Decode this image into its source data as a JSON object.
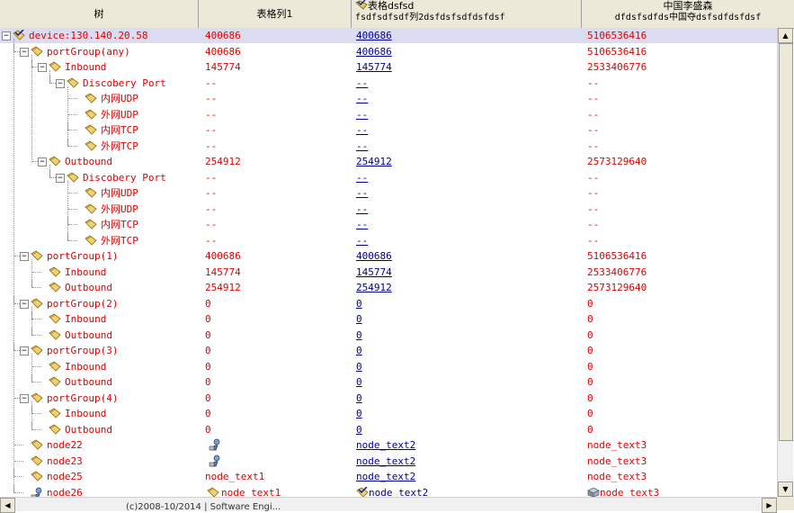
{
  "header": {
    "col0": "树",
    "col1": "表格列1",
    "col2_l1": "表格dsfsd",
    "col2_l2": "fsdfsdfsdf列2dsfdsfsdfdsfdsf",
    "col3_l1": "中国李盛森",
    "col3_l2": "dfdsfsdfds中国夺dsfsdfdsfdsf"
  },
  "rows": [
    {
      "label": "device:130.140.20.58",
      "depth": 0,
      "toggle": "−",
      "c1": "400686",
      "c2": "400686",
      "c3": "5106536416",
      "selected": true
    },
    {
      "label": "portGroup(any)",
      "depth": 1,
      "toggle": "−",
      "c1": "400686",
      "c2": "400686",
      "c3": "5106536416"
    },
    {
      "label": "Inbound",
      "depth": 2,
      "toggle": "−",
      "c1": "145774",
      "c2": "145774",
      "c3": "2533406776"
    },
    {
      "label": "Discobery Port",
      "depth": 3,
      "toggle": "−",
      "c1": "--",
      "c2": "--",
      "c3": "--"
    },
    {
      "label": "内网UDP",
      "depth": 4,
      "c1": "--",
      "c2": "--",
      "c3": "--"
    },
    {
      "label": "外网UDP",
      "depth": 4,
      "c1": "--",
      "c2": "--",
      "c3": "--"
    },
    {
      "label": "内网TCP",
      "depth": 4,
      "c1": "--",
      "c2": "--",
      "c3": "--"
    },
    {
      "label": "外网TCP",
      "depth": 4,
      "c1": "--",
      "c2": "--",
      "c3": "--"
    },
    {
      "label": "Outbound",
      "depth": 2,
      "toggle": "−",
      "c1": "254912",
      "c2": "254912",
      "c3": "2573129640"
    },
    {
      "label": "Discobery Port",
      "depth": 3,
      "toggle": "−",
      "c1": "--",
      "c2": "--",
      "c3": "--"
    },
    {
      "label": "内网UDP",
      "depth": 4,
      "c1": "--",
      "c2": "--",
      "c3": "--"
    },
    {
      "label": "外网UDP",
      "depth": 4,
      "c1": "--",
      "c2": "--",
      "c3": "--"
    },
    {
      "label": "内网TCP",
      "depth": 4,
      "c1": "--",
      "c2": "--",
      "c3": "--"
    },
    {
      "label": "外网TCP",
      "depth": 4,
      "c1": "--",
      "c2": "--",
      "c3": "--"
    },
    {
      "label": "portGroup(1)",
      "depth": 1,
      "toggle": "−",
      "c1": "400686",
      "c2": "400686",
      "c3": "5106536416"
    },
    {
      "label": "Inbound",
      "depth": 2,
      "c1": "145774",
      "c2": "145774",
      "c3": "2533406776"
    },
    {
      "label": "Outbound",
      "depth": 2,
      "c1": "254912",
      "c2": "254912",
      "c3": "2573129640"
    },
    {
      "label": "portGroup(2)",
      "depth": 1,
      "toggle": "−",
      "c1": "0",
      "c2": "0",
      "c3": "0"
    },
    {
      "label": "Inbound",
      "depth": 2,
      "c1": "0",
      "c2": "0",
      "c3": "0"
    },
    {
      "label": "Outbound",
      "depth": 2,
      "c1": "0",
      "c2": "0",
      "c3": "0"
    },
    {
      "label": "portGroup(3)",
      "depth": 1,
      "toggle": "−",
      "c1": "0",
      "c2": "0",
      "c3": "0"
    },
    {
      "label": "Inbound",
      "depth": 2,
      "c1": "0",
      "c2": "0",
      "c3": "0"
    },
    {
      "label": "Outbound",
      "depth": 2,
      "c1": "0",
      "c2": "0",
      "c3": "0"
    },
    {
      "label": "portGroup(4)",
      "depth": 1,
      "toggle": "−",
      "c1": "0",
      "c2": "0",
      "c3": "0"
    },
    {
      "label": "Inbound",
      "depth": 2,
      "c1": "0",
      "c2": "0",
      "c3": "0"
    },
    {
      "label": "Outbound",
      "depth": 2,
      "c1": "0",
      "c2": "0",
      "c3": "0"
    },
    {
      "label": "node22",
      "depth": 1,
      "c1": "",
      "c1icon": "person",
      "c2": "node_text2",
      "c3": "node_text3"
    },
    {
      "label": "node23",
      "depth": 1,
      "c1": "",
      "c1icon": "person",
      "c2": "node_text2",
      "c3": "node_text3"
    },
    {
      "label": "node25",
      "depth": 1,
      "c1": "node_text1",
      "c2": "node_text2",
      "c3": "node_text3"
    },
    {
      "label": "node26",
      "depth": 1,
      "icon": "person",
      "c1": "node_text1",
      "c1icon": "folder",
      "c2": "node_text2",
      "c2icon": "folder-check",
      "c3": "node_text3",
      "c3icon": "cube"
    }
  ],
  "icons": {
    "tree_node": "folder-icon",
    "root": "folder-check-icon"
  },
  "colors": {
    "value": "#e00000",
    "link": "#000090",
    "selected": "#dcdcf0",
    "header": "#ece9d8"
  },
  "status_text": "(c)2008-10/2014 | Software Engi..."
}
